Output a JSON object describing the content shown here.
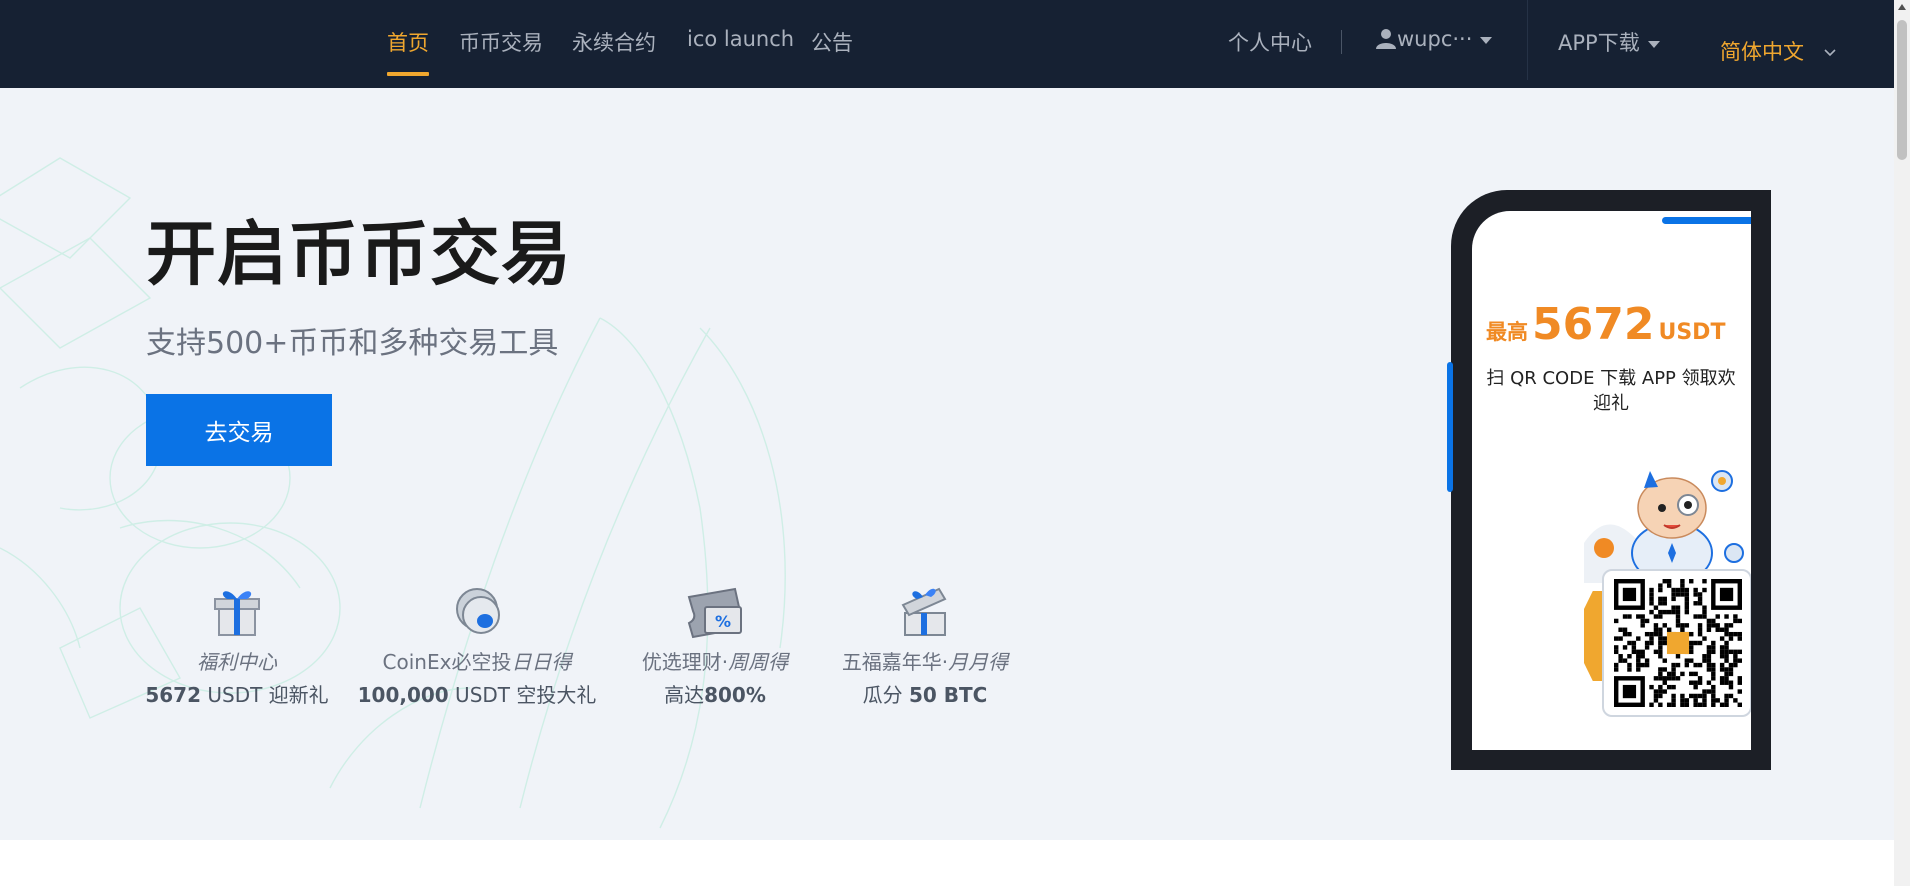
{
  "nav": {
    "home": "首页",
    "spot": "币币交易",
    "perpetual": "永续合约",
    "ico": "ico launch",
    "notice": "公告",
    "account": "个人中心",
    "user": "wupc···",
    "app_download": "APP下载",
    "language": "简体中文"
  },
  "hero": {
    "title": "开启币币交易",
    "subtitle": "支持500+币币和多种交易工具",
    "cta": "去交易"
  },
  "features": [
    {
      "icon": "gift-box-icon",
      "name_a": "",
      "name_b": "福利中心",
      "value_a": "5672",
      "value_b": " USDT 迎新礼"
    },
    {
      "icon": "coin-icon",
      "name_a": "CoinEx必空投",
      "name_b": "日日得",
      "value_a": "100,000",
      "value_b": " USDT 空投大礼"
    },
    {
      "icon": "coupon-ticket-icon",
      "name_a": "优选理财·",
      "name_b": "周周得",
      "value_a_pre": "高达",
      "value_a": "800%",
      "value_b": ""
    },
    {
      "icon": "open-gift-icon",
      "name_a": "五福嘉年华·",
      "name_b": "月月得",
      "value_a_pre": "瓜分 ",
      "value_a": "50 BTC",
      "value_b": ""
    }
  ],
  "phone": {
    "promo_prefix": "最高",
    "promo_amount": "5672",
    "promo_unit": "USDT",
    "promo_desc": "扫 QR CODE 下载 APP 领取欢迎礼"
  },
  "colors": {
    "nav_bg": "#162133",
    "accent": "#f0a72f",
    "primary": "#0a73e6",
    "hero_bg": "#f0f3f8",
    "promo": "#f08a24"
  }
}
